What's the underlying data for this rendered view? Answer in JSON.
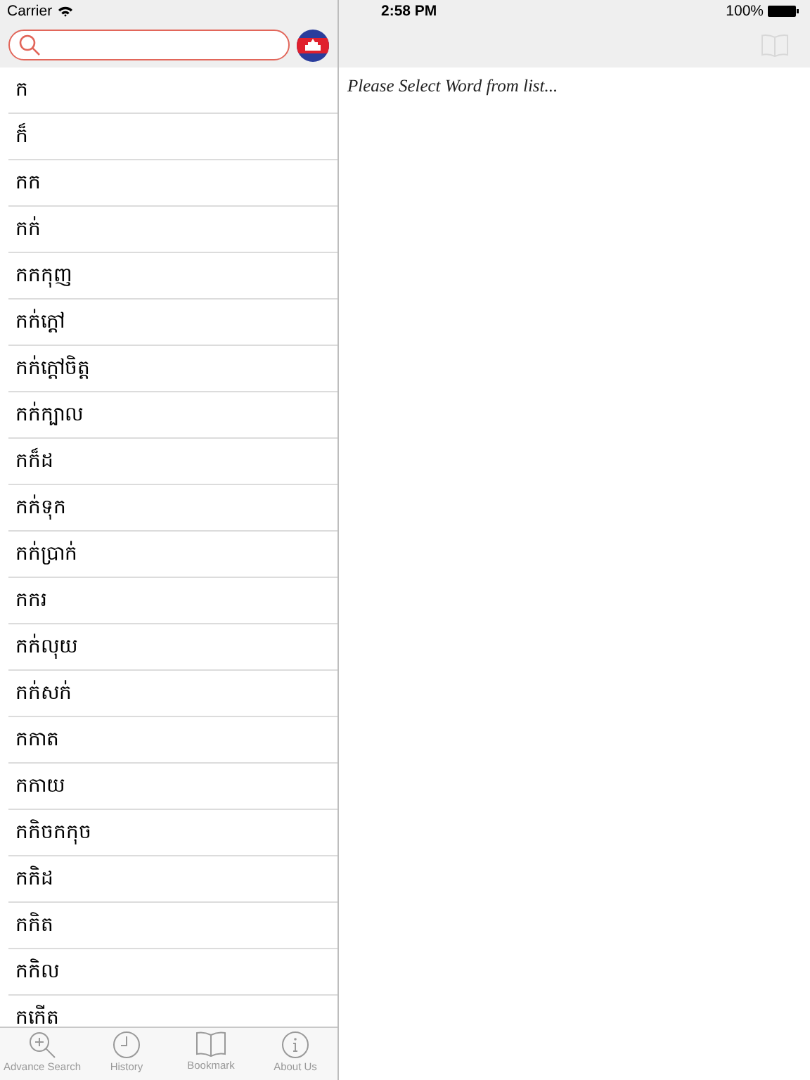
{
  "status_bar": {
    "carrier": "Carrier",
    "time": "2:58 PM",
    "battery": "100%"
  },
  "words": [
    "ក",
    "ក៏",
    "កក",
    "កក់",
    "កកកុញ",
    "កក់ក្ដៅ",
    "កក់ក្ដៅចិត្ត",
    "កក់ក្បាល",
    "កក៏ដ",
    "កក់ទុក",
    "កក់ប្រាក់",
    "កករ",
    "កក់លុយ",
    "កក់សក់",
    "កកាត",
    "កកាយ",
    "កកិចកកុច",
    "កកិដ",
    "កកិត",
    "កកិល",
    "កកើត"
  ],
  "detail": {
    "message": "Please Select Word from list..."
  },
  "tab_bar": [
    {
      "label": "Advance Search",
      "kind": "search"
    },
    {
      "label": "History",
      "kind": "clock"
    },
    {
      "label": "Bookmark",
      "kind": "book"
    },
    {
      "label": "About Us",
      "kind": "info"
    }
  ]
}
